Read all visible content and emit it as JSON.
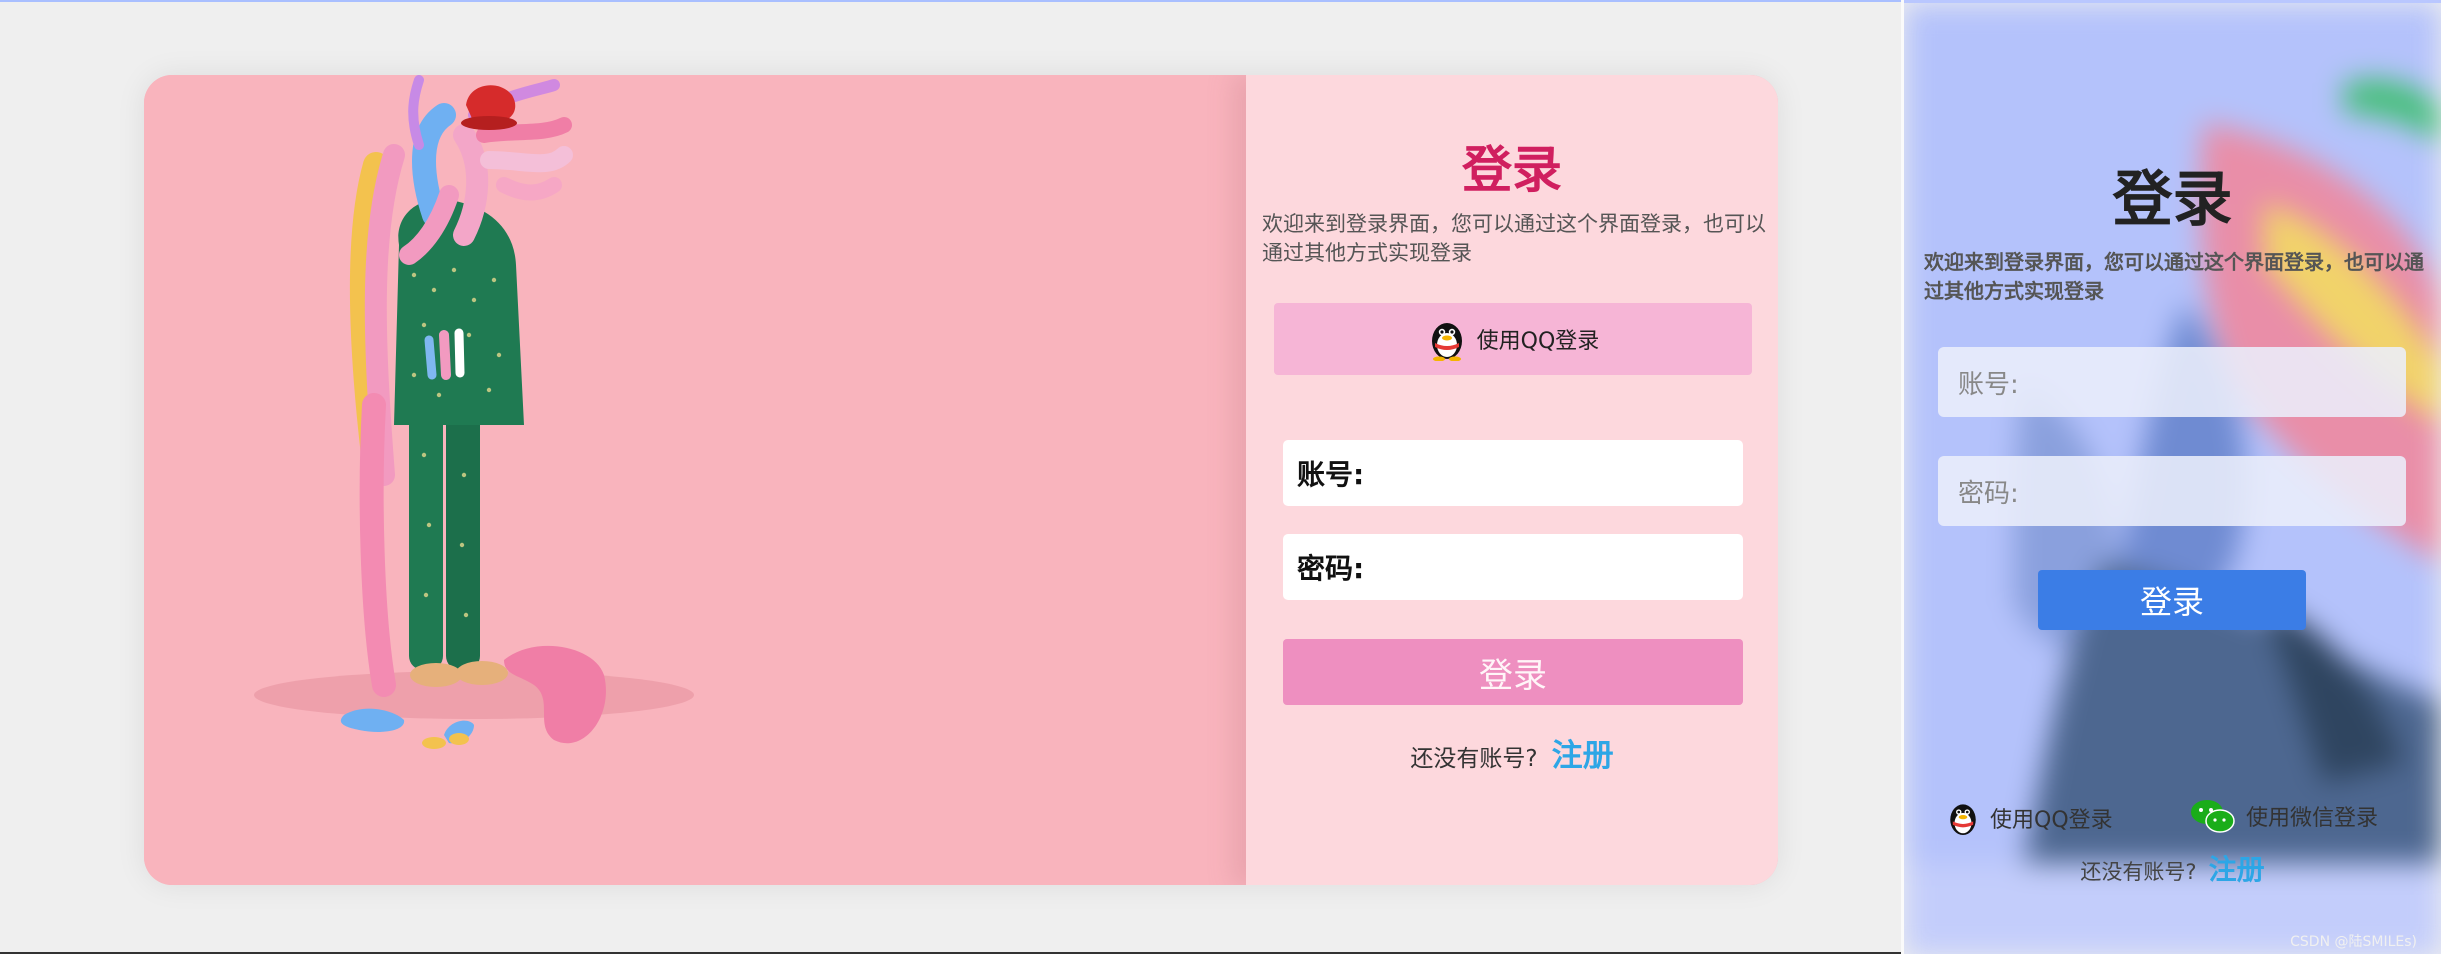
{
  "left": {
    "title": "登录",
    "description": "欢迎来到登录界面，您可以通过这个界面登录，也可以通过其他方式实现登录",
    "qq_button": "使用QQ登录",
    "account_label": "账号:",
    "password_label": "密码:",
    "submit": "登录",
    "signup_prompt": "还没有账号?",
    "signup_link": "注册"
  },
  "right": {
    "title": "登录",
    "description": "欢迎来到登录界面，您可以通过这个界面登录，也可以通过其他方式实现登录",
    "account_placeholder": "账号:",
    "password_placeholder": "密码:",
    "submit": "登录",
    "qq_label": "使用QQ登录",
    "wechat_label": "使用微信登录",
    "signup_prompt": "还没有账号?",
    "signup_link": "注册",
    "watermark": "CSDN @陆SMILEs)"
  },
  "icons": {
    "qq": "qq-penguin-icon",
    "wechat": "wechat-bubbles-icon"
  },
  "colors": {
    "title_pink": "#d01f5f",
    "qq_button_bg": "#f6b5d6",
    "submit_pink": "#ee8fc0",
    "signup_blue": "#2da6e6",
    "right_submit_blue": "#3b7de6"
  }
}
